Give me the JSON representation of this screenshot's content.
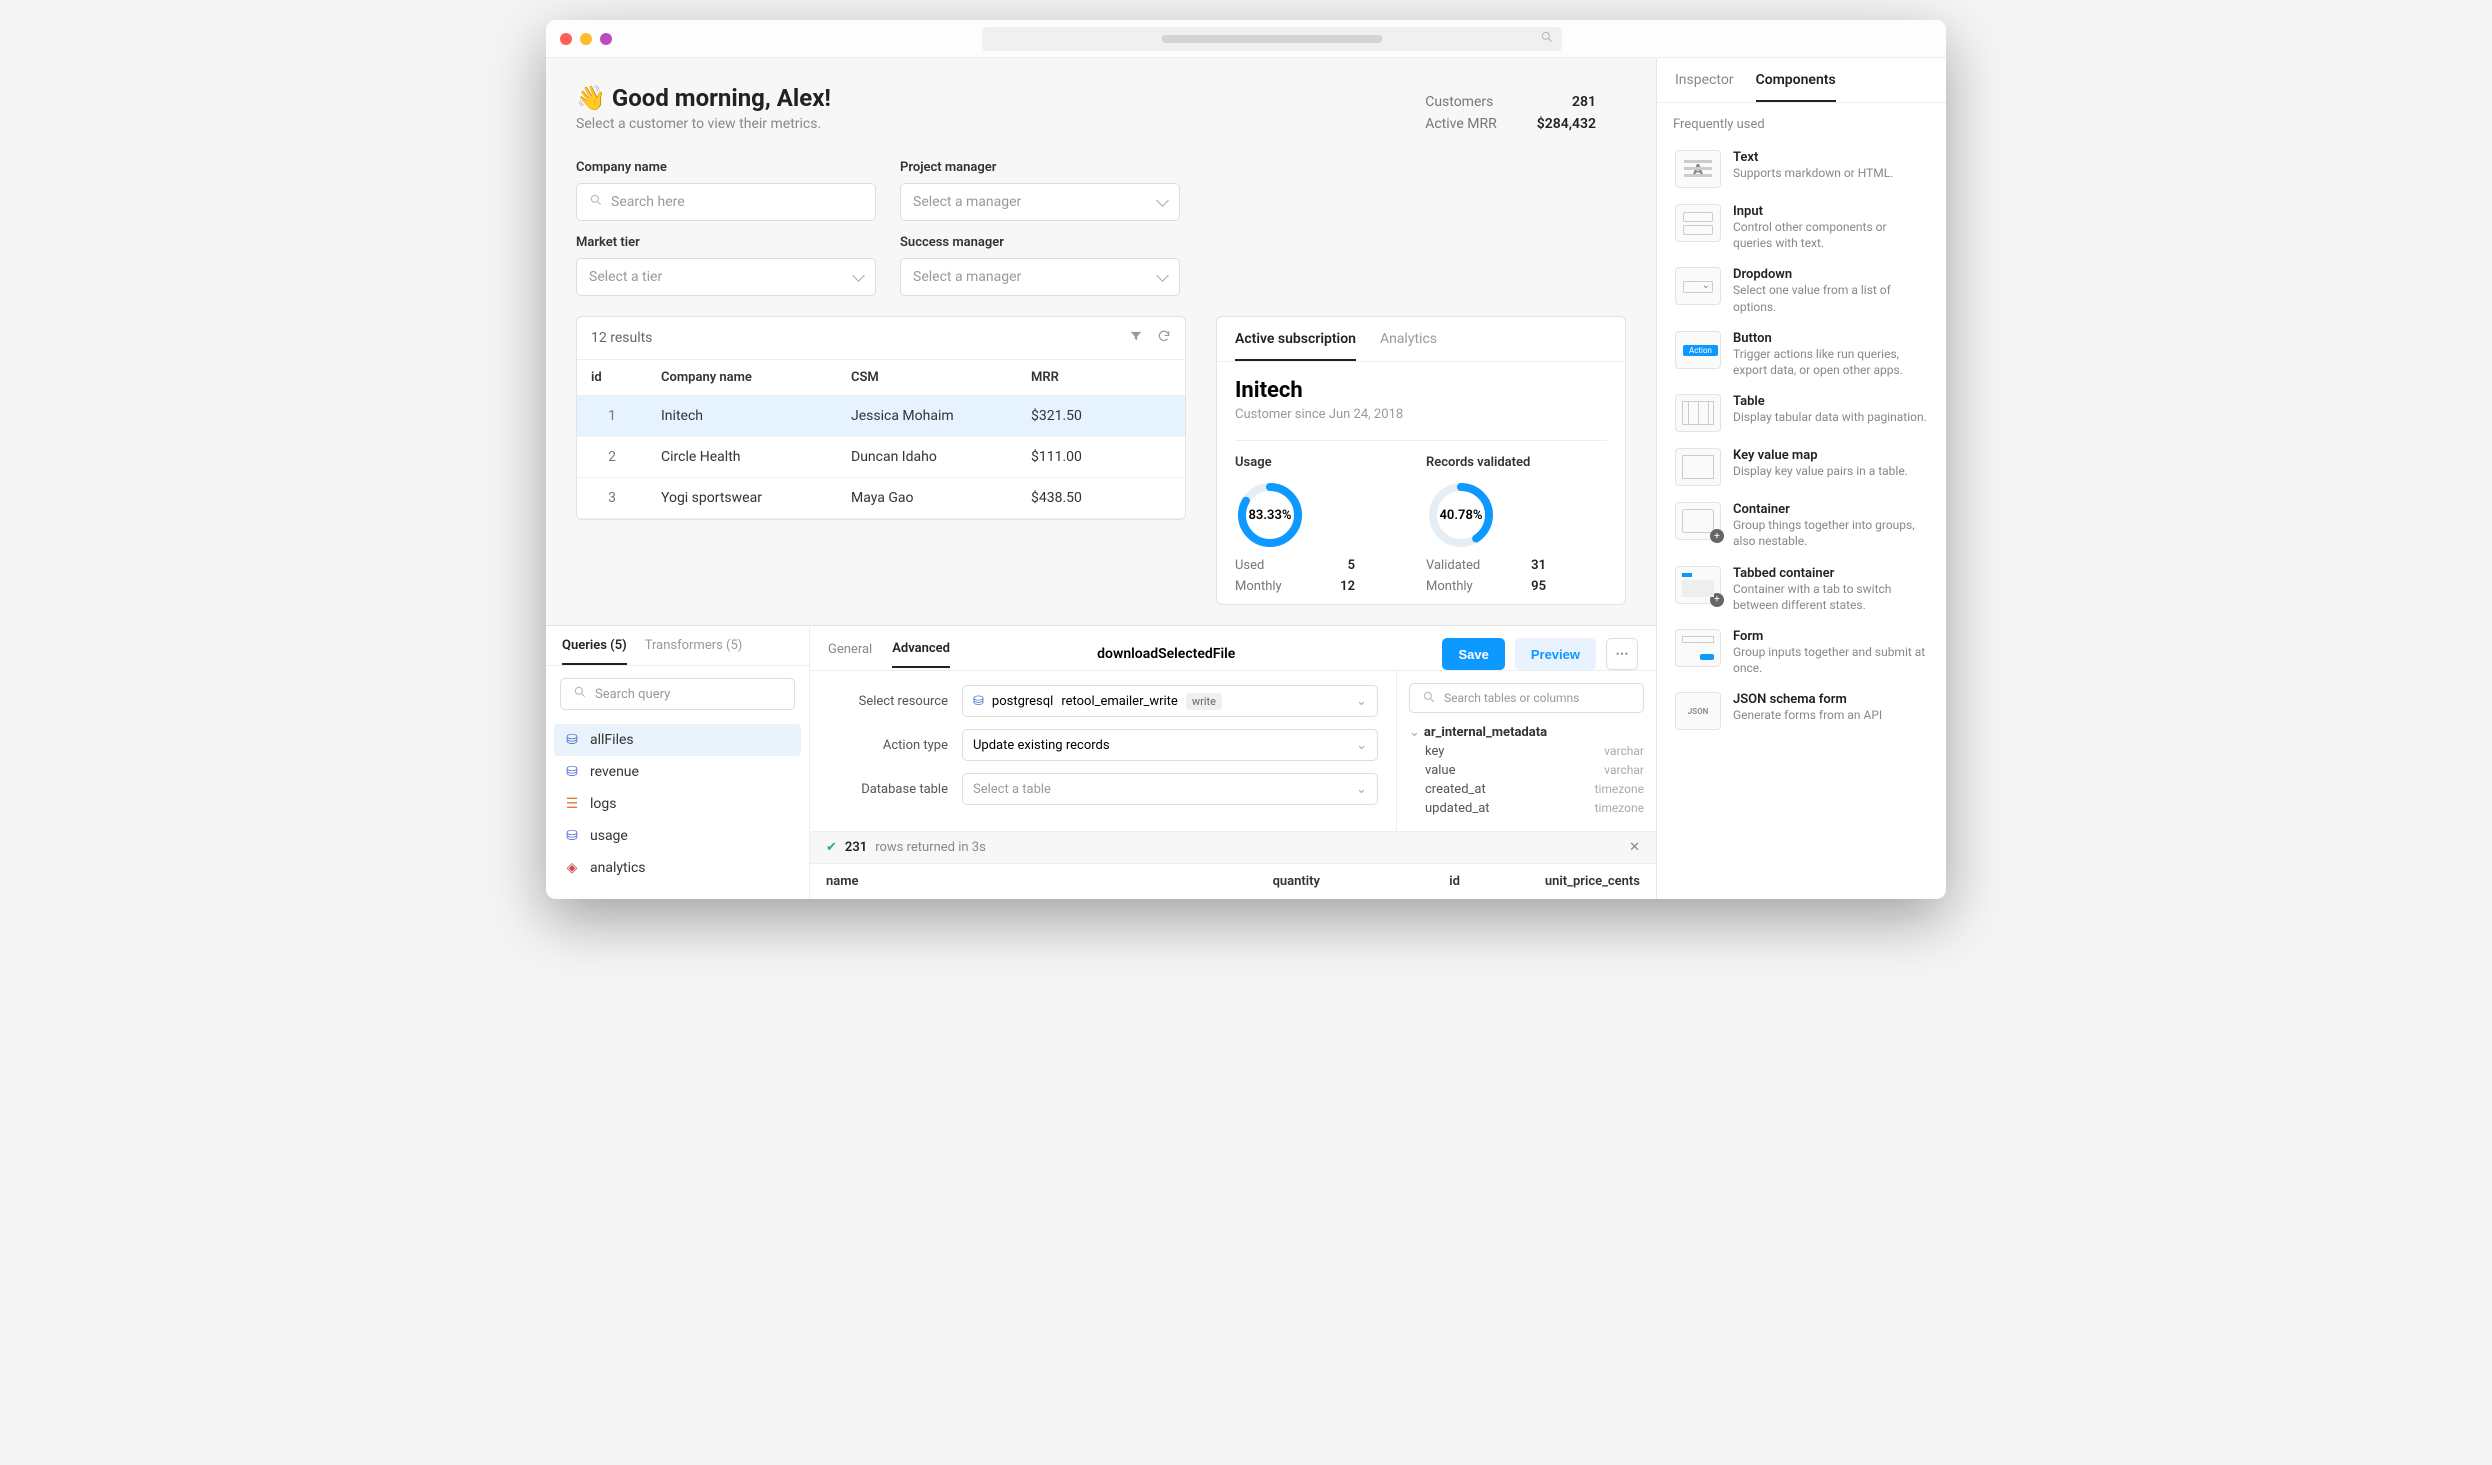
{
  "greeting": {
    "emoji": "👋",
    "title": "Good morning, Alex!",
    "subtitle": "Select a customer to view their metrics."
  },
  "summary": {
    "customers_label": "Customers",
    "customers": "281",
    "mrr_label": "Active MRR",
    "mrr": "$284,432"
  },
  "filters": {
    "company_label": "Company name",
    "company_placeholder": "Search here",
    "pm_label": "Project manager",
    "pm_placeholder": "Select a manager",
    "tier_label": "Market tier",
    "tier_placeholder": "Select a tier",
    "sm_label": "Success manager",
    "sm_placeholder": "Select a manager"
  },
  "table": {
    "count": "12 results",
    "cols": {
      "id": "id",
      "company": "Company name",
      "csm": "CSM",
      "mrr": "MRR"
    },
    "rows": [
      {
        "idx": "1",
        "company": "Initech",
        "csm": "Jessica Mohaim",
        "mrr": "$321.50"
      },
      {
        "idx": "2",
        "company": "Circle Health",
        "csm": "Duncan Idaho",
        "mrr": "$111.00"
      },
      {
        "idx": "3",
        "company": "Yogi sportswear",
        "csm": "Maya Gao",
        "mrr": "$438.50"
      }
    ]
  },
  "detail": {
    "tabs": {
      "active": "Active subscription",
      "analytics": "Analytics"
    },
    "name": "Initech",
    "since": "Customer since Jun 24, 2018",
    "usage": {
      "label": "Usage",
      "pct": "83.33%",
      "pct_num": 83.33,
      "used_lbl": "Used",
      "used": "5",
      "monthly_lbl": "Monthly",
      "monthly": "12"
    },
    "records": {
      "label": "Records validated",
      "pct": "40.78%",
      "pct_num": 40.78,
      "validated_lbl": "Validated",
      "validated": "31",
      "monthly_lbl": "Monthly",
      "monthly": "95"
    }
  },
  "bottom": {
    "left_tabs": {
      "queries": "Queries (5)",
      "transformers": "Transformers (5)"
    },
    "search_placeholder": "Search query",
    "queries": [
      {
        "name": "allFiles",
        "icon": "db",
        "color": "#3b63c4"
      },
      {
        "name": "revenue",
        "icon": "db",
        "color": "#3b63c4"
      },
      {
        "name": "logs",
        "icon": "stack",
        "color": "#e07a3a"
      },
      {
        "name": "usage",
        "icon": "db",
        "color": "#3b63c4"
      },
      {
        "name": "analytics",
        "icon": "cube",
        "color": "#d04848"
      }
    ],
    "right_tabs": {
      "general": "General",
      "advanced": "Advanced"
    },
    "title": "downloadSelectedFile",
    "actions": {
      "save": "Save",
      "preview": "Preview"
    },
    "form": {
      "resource_label": "Select resource",
      "resource": {
        "engine": "postgresql",
        "name": "retool_emailer_write",
        "perm": "write"
      },
      "action_label": "Action type",
      "action_value": "Update existing records",
      "table_label": "Database table",
      "table_placeholder": "Select a table"
    },
    "schema": {
      "search_placeholder": "Search tables or columns",
      "table": "ar_internal_metadata",
      "cols": [
        {
          "name": "key",
          "type": "varchar"
        },
        {
          "name": "value",
          "type": "varchar"
        },
        {
          "name": "created_at",
          "type": "timezone"
        },
        {
          "name": "updated_at",
          "type": "timezone"
        }
      ]
    },
    "status": {
      "count": "231",
      "text": "rows returned in 3s"
    },
    "result_cols": {
      "name": "name",
      "quantity": "quantity",
      "id": "id",
      "price": "unit_price_cents"
    }
  },
  "sidebar": {
    "tabs": {
      "inspector": "Inspector",
      "components": "Components"
    },
    "section": "Frequently used",
    "components": [
      {
        "title": "Text",
        "desc": "Supports markdown or HTML.",
        "thumb": "A"
      },
      {
        "title": "Input",
        "desc": "Control other components or queries with text.",
        "thumb": "input"
      },
      {
        "title": "Dropdown",
        "desc": "Select one value from a list of options.",
        "thumb": "dd"
      },
      {
        "title": "Button",
        "desc": "Trigger actions like run queries, export data, or open other apps.",
        "thumb": "btn"
      },
      {
        "title": "Table",
        "desc": "Display tabular data with pagination.",
        "thumb": "table"
      },
      {
        "title": "Key value map",
        "desc": "Display key value pairs in a table.",
        "thumb": "kv"
      },
      {
        "title": "Container",
        "desc": "Group things together into groups, also nestable.",
        "thumb": "container",
        "plus": true
      },
      {
        "title": "Tabbed container",
        "desc": "Container with a tab to switch between different states.",
        "thumb": "tabbed",
        "plus": true
      },
      {
        "title": "Form",
        "desc": "Group inputs together and submit at once.",
        "thumb": "form"
      },
      {
        "title": "JSON schema form",
        "desc": "Generate forms from an API",
        "thumb": "json"
      }
    ]
  }
}
